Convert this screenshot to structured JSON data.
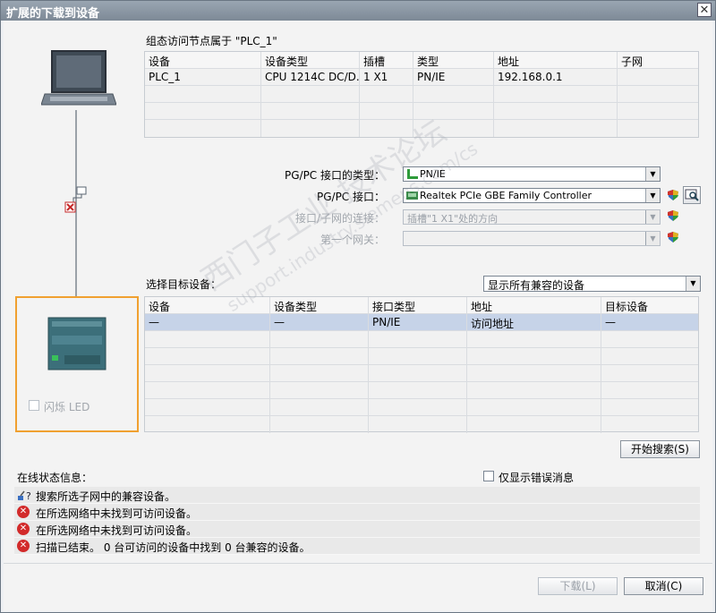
{
  "window": {
    "title": "扩展的下载到设备"
  },
  "node_table": {
    "caption": "组态访问节点属于 \"PLC_1\"",
    "headers": [
      "设备",
      "设备类型",
      "插槽",
      "类型",
      "地址",
      "子网"
    ],
    "rows": [
      [
        "PLC_1",
        "CPU 1214C DC/D...",
        "1 X1",
        "PN/IE",
        "192.168.0.1",
        ""
      ]
    ]
  },
  "interface": {
    "type_label": "PG/PC 接口的类型：",
    "type_value": "PN/IE",
    "iface_label": "PG/PC 接口：",
    "iface_value": "Realtek PCIe GBE Family Controller",
    "conn_label": "接口/子网的连接：",
    "conn_value": "插槽\"1 X1\"处的方向",
    "gateway_label": "第一个网关：",
    "gateway_value": ""
  },
  "target": {
    "label": "选择目标设备：",
    "filter_value": "显示所有兼容的设备",
    "headers": [
      "设备",
      "设备类型",
      "接口类型",
      "地址",
      "目标设备"
    ],
    "rows": [
      [
        "—",
        "—",
        "PN/IE",
        "访问地址",
        "—"
      ]
    ]
  },
  "flash_led": {
    "label": "闪烁 LED"
  },
  "search_button": "开始搜索(S)",
  "status": {
    "label": "在线状态信息：",
    "only_errors_label": "仅显示错误消息",
    "messages": [
      {
        "icon": "search-progress-icon",
        "text": "搜索所选子网中的兼容设备。"
      },
      {
        "icon": "error-icon",
        "text": "在所选网络中未找到可访问设备。"
      },
      {
        "icon": "error-icon",
        "text": "在所选网络中未找到可访问设备。"
      },
      {
        "icon": "error-icon",
        "text": "扫描已结束。 0 台可访问的设备中找到 0 台兼容的设备。"
      }
    ]
  },
  "footer": {
    "download_label": "下载(L)",
    "cancel_label": "取消(C)"
  },
  "watermark": {
    "line1": "西门子工业 技术论坛",
    "line2": "support.industry.siemens.com/cs"
  },
  "colors": {
    "accent_orange": "#f0a030",
    "selection": "#c6d3e8",
    "error_red": "#d22a2a",
    "pnie_green": "#2e9b3a"
  }
}
